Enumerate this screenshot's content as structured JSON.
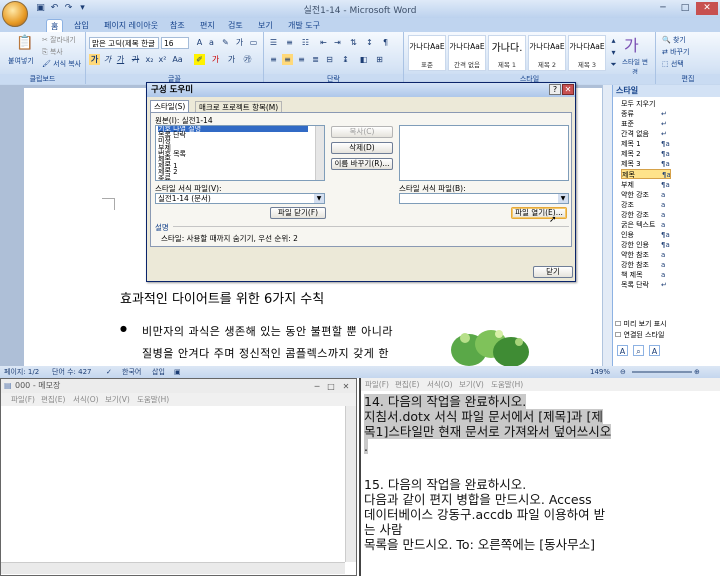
{
  "word": {
    "window_title": "실전1-14 - Microsoft Word",
    "quick_access": [
      "save-icon",
      "undo-icon",
      "redo-icon",
      "dropdown-icon"
    ],
    "tabs": [
      "홈",
      "삽입",
      "페이지 레이아웃",
      "참조",
      "편지",
      "검토",
      "보기",
      "개발 도구"
    ],
    "active_tab": "홈",
    "ribbon": {
      "clipboard": {
        "paste": "붙여넣기",
        "cut": "잘라내기",
        "copy": "복사",
        "format_painter": "서식 복사",
        "label": "클립보드"
      },
      "font": {
        "name": "맑은 고딕(제목 한글",
        "size": "16",
        "label": "글꼴",
        "bold": "가",
        "italic": "가",
        "underline": "가",
        "strike": "가",
        "color": "가"
      },
      "paragraph": {
        "label": "단락"
      },
      "styles": {
        "label": "스타일",
        "items": [
          {
            "preview": "가나다AaE",
            "name": "표준"
          },
          {
            "preview": "가나다AaE",
            "name": "간격 없음"
          },
          {
            "preview": "가나다.",
            "name": "제목 1"
          },
          {
            "preview": "가나다AaE",
            "name": "제목 2"
          },
          {
            "preview": "가나다AaE",
            "name": "제목 3"
          }
        ],
        "change": "스타일 변경"
      },
      "edit": {
        "find": "찾기",
        "replace": "바꾸기",
        "select": "선택",
        "label": "편집"
      }
    },
    "document": {
      "heading": "효과적인 다이어트를 위한 6가지 수칙",
      "paragraph_line1": "비만자의 과식은 생존해 있는 동안 불편할 뿐 아니라",
      "paragraph_line2": "질병을 안겨다 주며 정신적인 콤플렉스까지 갖게 한"
    },
    "status": {
      "page": "페이지: 1/2",
      "words": "단어 수: 427",
      "lang": "한국어",
      "mode": "삽입",
      "zoom": "149%"
    }
  },
  "style_pane": {
    "title": "스타일",
    "items": [
      "모두 지우기",
      "종류",
      "표준",
      "간격 없음",
      "제목 1",
      "제목 2",
      "제목 3",
      "제목",
      "부제",
      "약한 강조",
      "강조",
      "강한 강조",
      "굵은 텍스트",
      "인용",
      "강한 인용",
      "약한 참조",
      "강한 참조",
      "책 제목",
      "목록 단락"
    ],
    "selected": "제목",
    "preview_label": "미리 보기 표시",
    "linked_label": "연결된 스타일"
  },
  "dialog": {
    "title": "구성 도우미",
    "tabs": [
      "스타일(S)",
      "매크로 프로젝트 항목(M)"
    ],
    "source_label": "원본(I): 실전1-14",
    "left_list": [
      "기호 나열 설명",
      "목록 단락",
      "미정",
      "부제",
      "번호 목록",
      "제목",
      "제목 1",
      "제목 2",
      "종류"
    ],
    "buttons": {
      "copy": "복사(C)",
      "delete": "삭제(D)",
      "rename": "이름 바꾸기(R)...",
      "close_file": "파일 닫기(F)",
      "open_file": "파일 열기(E)...",
      "close": "닫기"
    },
    "left_style_label": "스타일 서식 파일(V):",
    "left_style_value": "실전1-14 (문서)",
    "right_style_label": "스타일 서식 파일(B):",
    "right_style_value": "",
    "desc_label": "설명",
    "desc_text": "스타일: 사용할 때까지 숨기기, 우선 순위: 2"
  },
  "notepad": {
    "title": "000 - 메모장",
    "menu": [
      "파일(F)",
      "편집(E)",
      "서식(O)",
      "보기(V)",
      "도움말(H)"
    ]
  },
  "rightpad": {
    "menu": [
      "파일(F)",
      "편집(E)",
      "서식(O)",
      "보기(V)",
      "도움말(H)"
    ],
    "lines": [
      "14. 다음의 작업을 완료하시오.",
      "    지침서.dotx 서식 파일 문서에서 [제목]과 [제",
      "목1]스타일만 현재 문서로 가져와서 덮어쓰시오",
      ".",
      "",
      "15. 다음의 작업을 완료하시오.",
      "    다음과 같이 편지 병합을 만드시오. Access",
      "데이터베이스 강동구.accdb 파일 이용하여 받",
      "는 사람",
      "    목록을 만드시오. To: 오른쪽에는 [동사무소]"
    ]
  }
}
